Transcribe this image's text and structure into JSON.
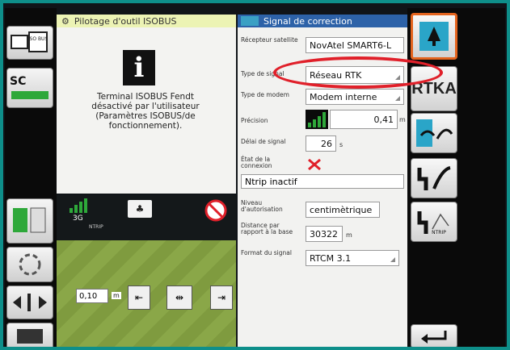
{
  "left_panel": {
    "title": "Pilotage d'outil ISOBUS",
    "message_line1": "Terminal ISOBUS Fendt",
    "message_line2": "désactivé par l'utilisateur",
    "message_line3": "(Paramètres ISOBUS/de",
    "message_line4": "fonctionnement)."
  },
  "guidance": {
    "network": "3G",
    "ntrip": "NTRIP",
    "offset_value": "0,10",
    "offset_unit": "m"
  },
  "right_panel": {
    "title": "Signal de correction",
    "receiver_label": "Récepteur satellite",
    "receiver_value": "NovAtel SMART6-L",
    "signal_type_label": "Type de signal",
    "signal_type_value": "Réseau RTK",
    "modem_type_label": "Type de modem",
    "modem_type_value": "Modem interne",
    "precision_label": "Précision",
    "precision_value": "0,41",
    "precision_unit": "m",
    "delay_label": "Délai de signal",
    "delay_value": "26",
    "delay_unit": "s",
    "connection_label": "État de la connexion",
    "ntrip_status": "Ntrip inactif",
    "auth_label": "Niveau d'autorisation",
    "auth_value": "centimètrique",
    "distance_label": "Distance par rapport à la base",
    "distance_value": "30322",
    "distance_unit": "m",
    "format_label": "Format du signal",
    "format_value": "RTCM 3.1"
  },
  "side": {
    "isobus_label": "ISO BUS",
    "sc_label": "SC",
    "rtka_label": "RTKA",
    "ntrip_button_label": "NTRIP"
  },
  "colors": {
    "accent_orange": "#e4641e",
    "header_blue": "#2d62a8",
    "highlight_red": "#e0202a",
    "signal_green": "#2ea83a"
  }
}
